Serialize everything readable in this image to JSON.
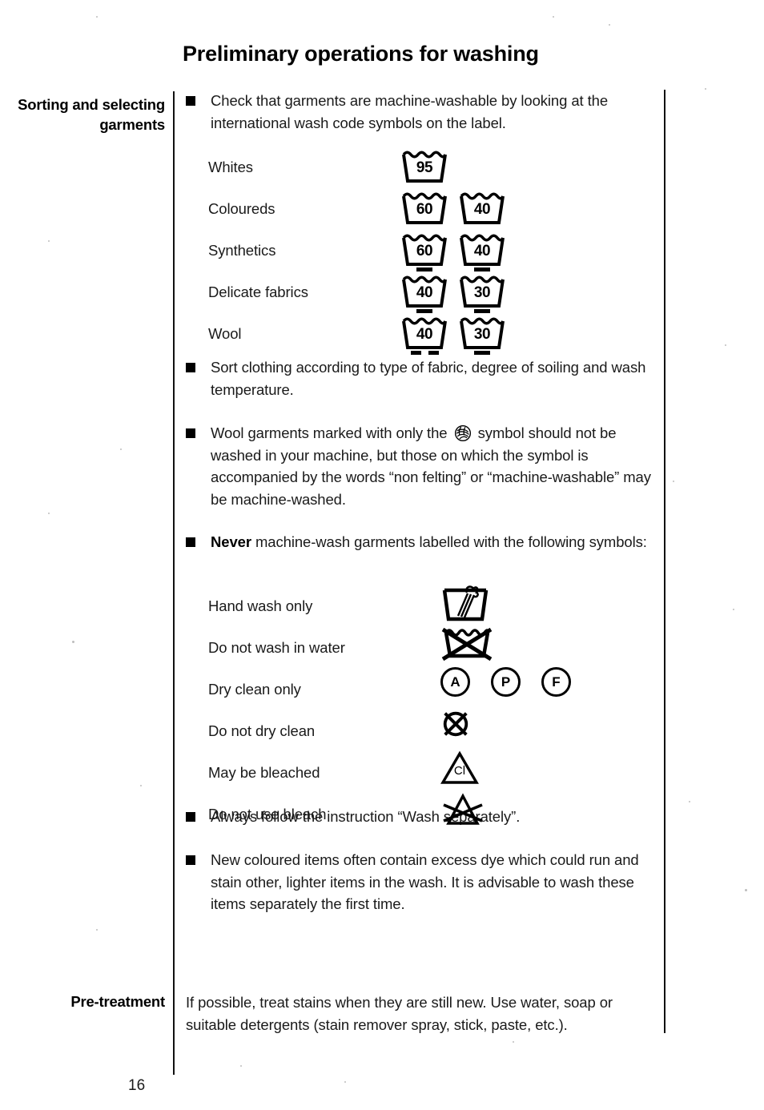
{
  "page": {
    "title": "Preliminary operations for washing",
    "number": "16"
  },
  "sections": {
    "sorting_heading": "Sorting and selecting garments",
    "pretreatment_heading": "Pre-treatment",
    "pretreatment_text": "If possible, treat stains when they are still new. Use water, soap or suitable detergents (stain remover spray, stick, paste, etc.)."
  },
  "bullets": {
    "b1": "Check that garments are machine-washable by looking at the international wash code symbols on the label.",
    "b2": "Sort clothing according to type of fabric, degree of soiling and wash temperature.",
    "b3_part1": "Wool garments marked with only the",
    "b3_part2": "symbol should not be washed in your machine, but those on which the symbol is accompanied by the words “non felting” or “machine-washable” may be machine-washed.",
    "b4_strong": "Never",
    "b4_rest": "machine-wash garments labelled with the following symbols:",
    "b5": "Always follow the instruction “Wash separately”.",
    "b6": "New coloured items often contain excess dye which could run and stain other, lighter items in the wash. It is advisable to wash these items separately the first time."
  },
  "wash_codes": [
    {
      "label": "Whites",
      "symbols": [
        {
          "temp": "95",
          "bars": 0
        }
      ]
    },
    {
      "label": "Coloureds",
      "symbols": [
        {
          "temp": "60",
          "bars": 0
        },
        {
          "temp": "40",
          "bars": 0
        }
      ]
    },
    {
      "label": "Synthetics",
      "symbols": [
        {
          "temp": "60",
          "bars": 1
        },
        {
          "temp": "40",
          "bars": 1
        }
      ]
    },
    {
      "label": "Delicate fabrics",
      "symbols": [
        {
          "temp": "40",
          "bars": 1
        },
        {
          "temp": "30",
          "bars": 1
        }
      ]
    },
    {
      "label": "Wool",
      "symbols": [
        {
          "temp": "40",
          "bars": 2
        },
        {
          "temp": "30",
          "bars": 1
        }
      ]
    }
  ],
  "never_symbols": [
    {
      "label": "Hand wash only",
      "icon": "hand-wash-tub-icon"
    },
    {
      "label": "Do not wash in water",
      "icon": "crossed-tub-icon"
    },
    {
      "label": "Dry clean only",
      "icon": "dry-clean-circles-icon",
      "letters": [
        "A",
        "P",
        "F"
      ]
    },
    {
      "label": "Do not dry clean",
      "icon": "crossed-circle-icon"
    },
    {
      "label": "May be bleached",
      "icon": "bleach-triangle-icon",
      "letters": [
        "Cl"
      ]
    },
    {
      "label": "Do not use bleach",
      "icon": "crossed-triangle-icon"
    }
  ],
  "colors": {
    "ink": "#111111",
    "paper": "#ffffff"
  }
}
